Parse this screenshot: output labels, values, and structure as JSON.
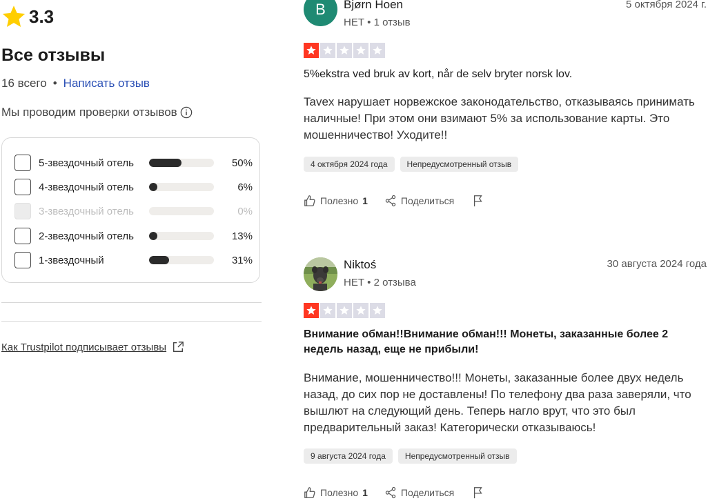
{
  "summary": {
    "rating": "3.3",
    "all_reviews_title": "Все отзывы",
    "total": "16 всего",
    "write_review": "Написать отзыв",
    "verification_text": "Мы проводим проверки отзывов",
    "trust_link": "Как Trustpilot подписывает отзывы"
  },
  "filters": [
    {
      "label": "5-звездочный отель",
      "pct": "50%",
      "fraction": 0.5,
      "disabled": false
    },
    {
      "label": "4-звездочный отель",
      "pct": "6%",
      "fraction": 0.06,
      "disabled": false
    },
    {
      "label": "3-звездочный отель",
      "pct": "0%",
      "fraction": 0.0,
      "disabled": true
    },
    {
      "label": "2-звездочный отель",
      "pct": "13%",
      "fraction": 0.13,
      "disabled": false
    },
    {
      "label": "1-звездочный",
      "pct": "31%",
      "fraction": 0.31,
      "disabled": false
    }
  ],
  "reviews": [
    {
      "avatar_letter": "B",
      "author": "Bjørn Hoen",
      "meta": "НЕТ • 1 отзыв",
      "date": "5 октября 2024 г.",
      "stars": 1,
      "title": "5%ekstra ved bruk av kort, når de selv bryter norsk lov.",
      "body": "Tavex нарушает норвежское законодательство, отказываясь принимать наличные! При этом они взимают 5% за использование карты. Это мошенничество! Уходите!!",
      "date_tag": "4 октября 2024 года",
      "type_tag": "Непредусмотренный отзыв",
      "helpful": "Полезно",
      "helpful_count": "1",
      "share": "Поделиться"
    },
    {
      "author": "Niktoś",
      "meta": "НЕТ • 2 отзыва",
      "date": "30 августа 2024 года",
      "stars": 1,
      "title": "Внимание обман!!Внимание обман!!! Монеты, заказанные более 2 недель назад, еще не прибыли!",
      "body": "Внимание, мошенничество!!! Монеты, заказанные более двух недель назад, до сих пор не доставлены! По телефону два раза заверяли, что вышлют на следующий день. Теперь нагло врут, что это был предварительный заказ! Категорически отказываюсь!",
      "date_tag": "9 августа 2024 года",
      "type_tag": "Непредусмотренный отзыв",
      "helpful": "Полезно",
      "helpful_count": "1",
      "share": "Поделиться"
    }
  ],
  "colors": {
    "accent_link": "#2a4fb5",
    "star_red": "#ff3722",
    "star_gold": "#ffce00",
    "avatar_green": "#1f8a73"
  }
}
